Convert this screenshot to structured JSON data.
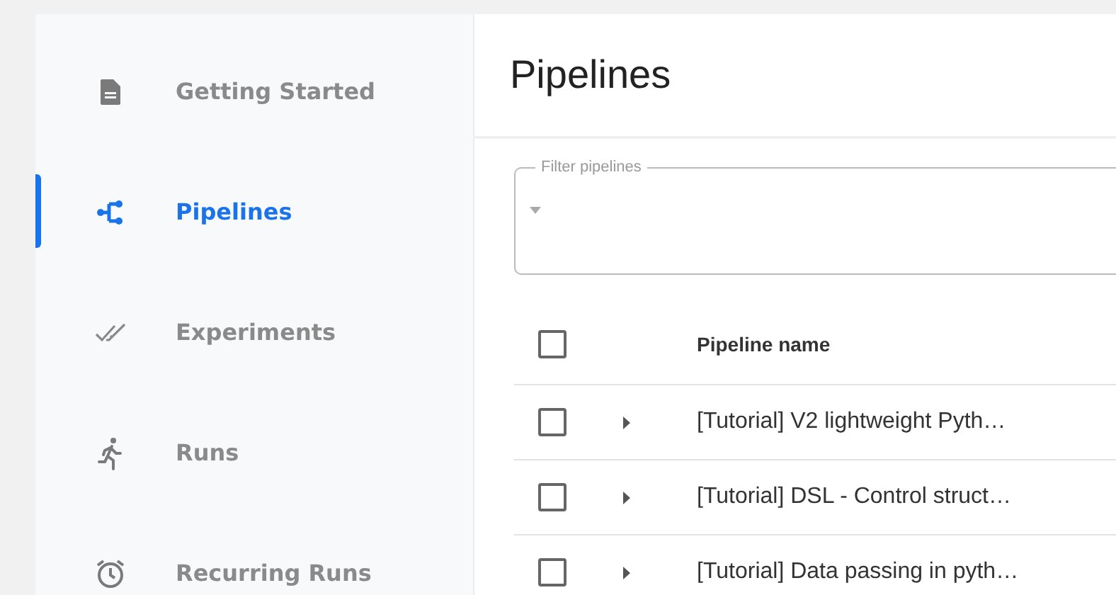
{
  "sidebar": {
    "items": [
      {
        "label": "Getting Started",
        "selected": false
      },
      {
        "label": "Pipelines",
        "selected": true
      },
      {
        "label": "Experiments",
        "selected": false
      },
      {
        "label": "Runs",
        "selected": false
      },
      {
        "label": "Recurring Runs",
        "selected": false
      }
    ]
  },
  "page": {
    "title": "Pipelines"
  },
  "filter": {
    "label": "Filter pipelines"
  },
  "table": {
    "header_checked": false,
    "columns": [
      "Pipeline name"
    ],
    "rows": [
      {
        "name": "[Tutorial] V2 lightweight Pyth…",
        "checked": false,
        "expanded": false
      },
      {
        "name": "[Tutorial] DSL - Control struct…",
        "checked": false,
        "expanded": false
      },
      {
        "name": "[Tutorial] Data passing in pyth…",
        "checked": false,
        "expanded": false
      }
    ]
  }
}
